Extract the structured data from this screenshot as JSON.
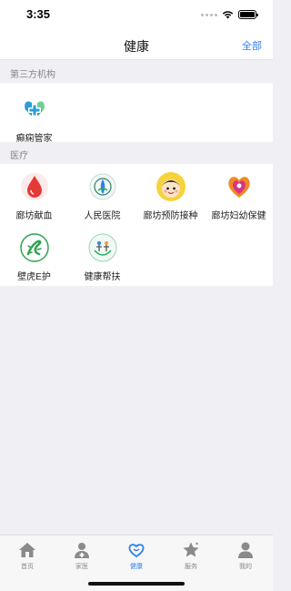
{
  "status": {
    "time": "3:35"
  },
  "nav": {
    "title": "健康",
    "right_action": "全部"
  },
  "sections": {
    "third_party": {
      "title": "第三方机构",
      "items": [
        {
          "label": "癫痫管家",
          "icon": "epilepsy-manager-icon"
        }
      ]
    },
    "medical": {
      "title": "医疗",
      "items": [
        {
          "label": "廊坊献血",
          "icon": "blood-drop-icon"
        },
        {
          "label": "人民医院",
          "icon": "hospital-emblem-icon"
        },
        {
          "label": "廊坊预防接种",
          "icon": "child-face-icon"
        },
        {
          "label": "廊坊妇幼保健",
          "icon": "maternal-heart-icon"
        },
        {
          "label": "壁虎E护",
          "icon": "gecko-icon"
        },
        {
          "label": "健康帮扶",
          "icon": "health-support-icon"
        }
      ]
    }
  },
  "tabs": [
    {
      "label": "首页",
      "icon": "home-icon",
      "active": false
    },
    {
      "label": "家医",
      "icon": "family-doctor-icon",
      "active": false
    },
    {
      "label": "健康",
      "icon": "heart-icon",
      "active": true
    },
    {
      "label": "服务",
      "icon": "star-icon",
      "active": false
    },
    {
      "label": "我的",
      "icon": "person-icon",
      "active": false
    }
  ],
  "colors": {
    "accent": "#2f80ed",
    "background": "#efeff4",
    "tab_inactive": "#888888"
  }
}
